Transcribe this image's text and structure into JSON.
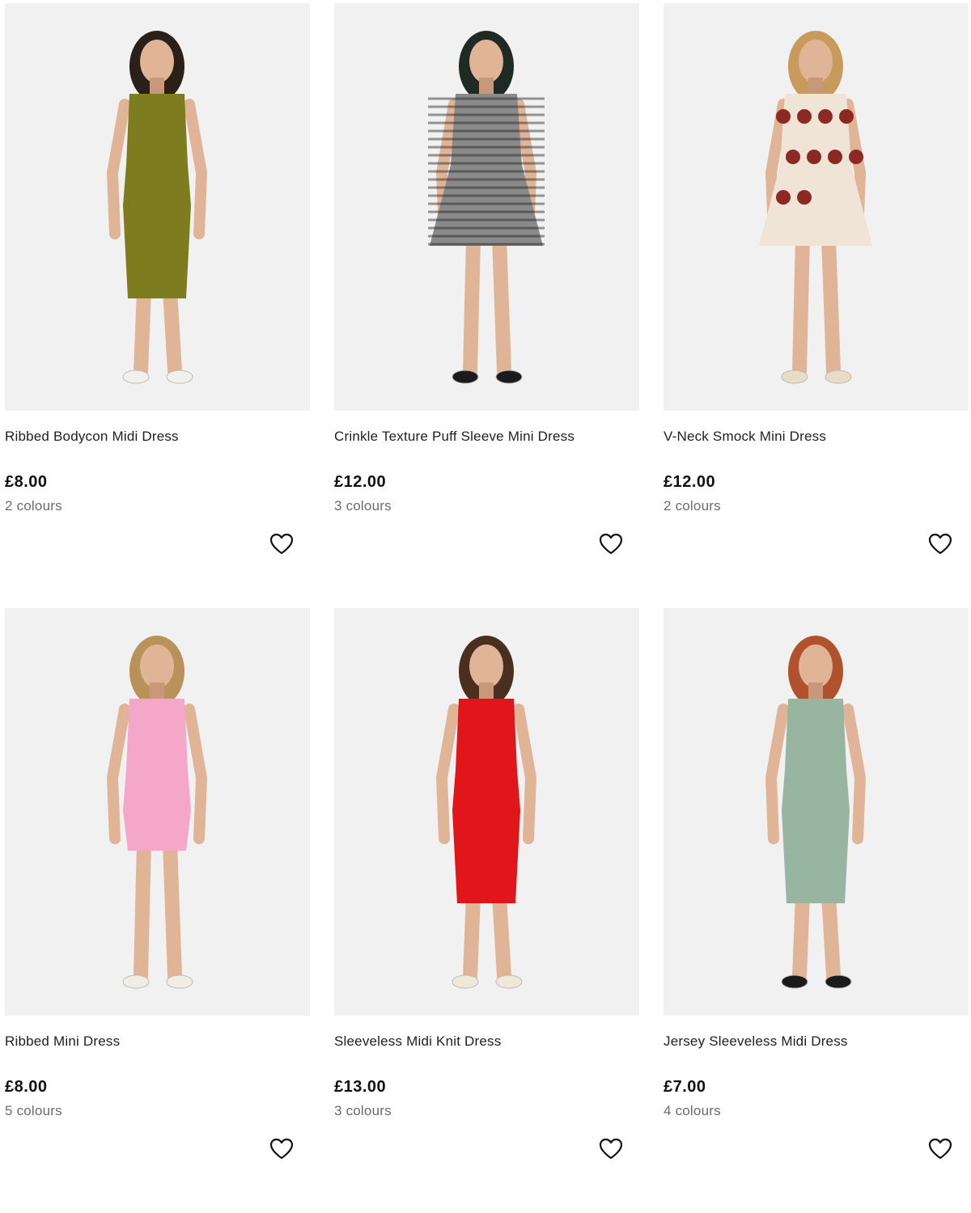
{
  "products": [
    {
      "name": "Ribbed Bodycon Midi Dress",
      "price": "£8.00",
      "colours": "2 colours",
      "dress_color": "#7d7c1f",
      "hair_color": "#2b2018",
      "shoe_color": "#f2f0ea",
      "dress_style": "midi-bodycon"
    },
    {
      "name": "Crinkle Texture Puff Sleeve Mini Dress",
      "price": "£12.00",
      "colours": "3 colours",
      "dress_color": "#8a8a8a",
      "hair_color": "#1f2a24",
      "shoe_color": "#1b1b1b",
      "dress_style": "mini-gingham"
    },
    {
      "name": "V-Neck Smock Mini Dress",
      "price": "£12.00",
      "colours": "2 colours",
      "dress_color": "#efe4d6",
      "hair_color": "#c89a5c",
      "shoe_color": "#e9dcc6",
      "dress_style": "mini-smock"
    },
    {
      "name": "Ribbed Mini Dress",
      "price": "£8.00",
      "colours": "5 colours",
      "dress_color": "#f4a7c8",
      "hair_color": "#b9925a",
      "shoe_color": "#f0ede6",
      "dress_style": "mini-bodycon"
    },
    {
      "name": "Sleeveless Midi Knit Dress",
      "price": "£13.00",
      "colours": "3 colours",
      "dress_color": "#e0161a",
      "hair_color": "#4a2e1e",
      "shoe_color": "#efe7d7",
      "dress_style": "midi-bodycon"
    },
    {
      "name": "Jersey Sleeveless Midi Dress",
      "price": "£7.00",
      "colours": "4 colours",
      "dress_color": "#98b5a2",
      "hair_color": "#b0522e",
      "shoe_color": "#1b1b1b",
      "dress_style": "midi-bodycon"
    }
  ],
  "icons": {
    "wishlist": "heart-outline-icon"
  }
}
